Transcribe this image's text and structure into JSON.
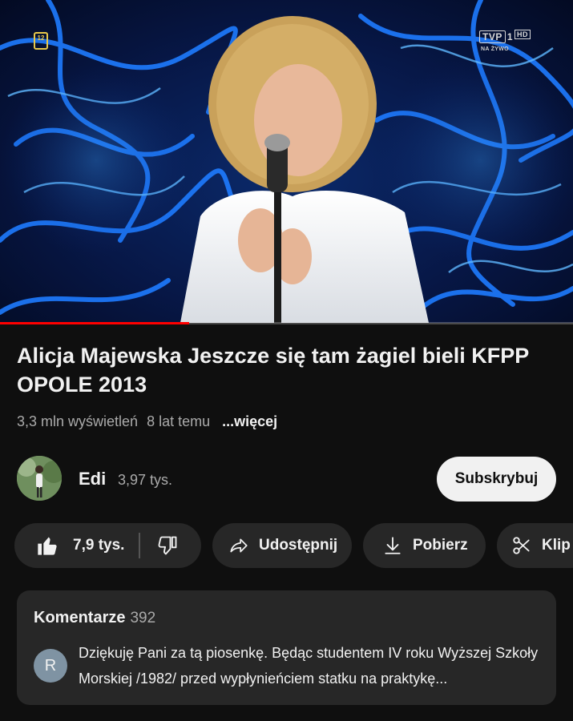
{
  "player": {
    "age_rating": "12",
    "channel_logo": "TVP",
    "channel_number": "1",
    "hd_label": "HD",
    "live_label": "NA ŻYWO",
    "progress_fraction": 0.33
  },
  "video": {
    "title": "Alicja Majewska Jeszcze się tam żagiel bieli KFPP OPOLE 2013",
    "views": "3,3 mln wyświetleń",
    "age": "8 lat temu",
    "more_label": "...więcej"
  },
  "channel": {
    "name": "Edi",
    "subscribers": "3,97 tys.",
    "subscribe_label": "Subskrybuj"
  },
  "actions": {
    "likes": "7,9 tys.",
    "share_label": "Udostępnij",
    "download_label": "Pobierz",
    "clip_label": "Klip"
  },
  "comments": {
    "header": "Komentarze",
    "count": "392",
    "first": {
      "avatar_letter": "R",
      "text": "Dziękuję Pani za tą piosenkę. Będąc studentem IV roku Wyższej Szkoły Morskiej /1982/ przed wypłynieńciem statku na praktykę..."
    }
  },
  "colors": {
    "background": "#0f0f0f",
    "pill": "#272727",
    "accent_red": "#ff0000",
    "stage_blue": "#1e7bff"
  }
}
